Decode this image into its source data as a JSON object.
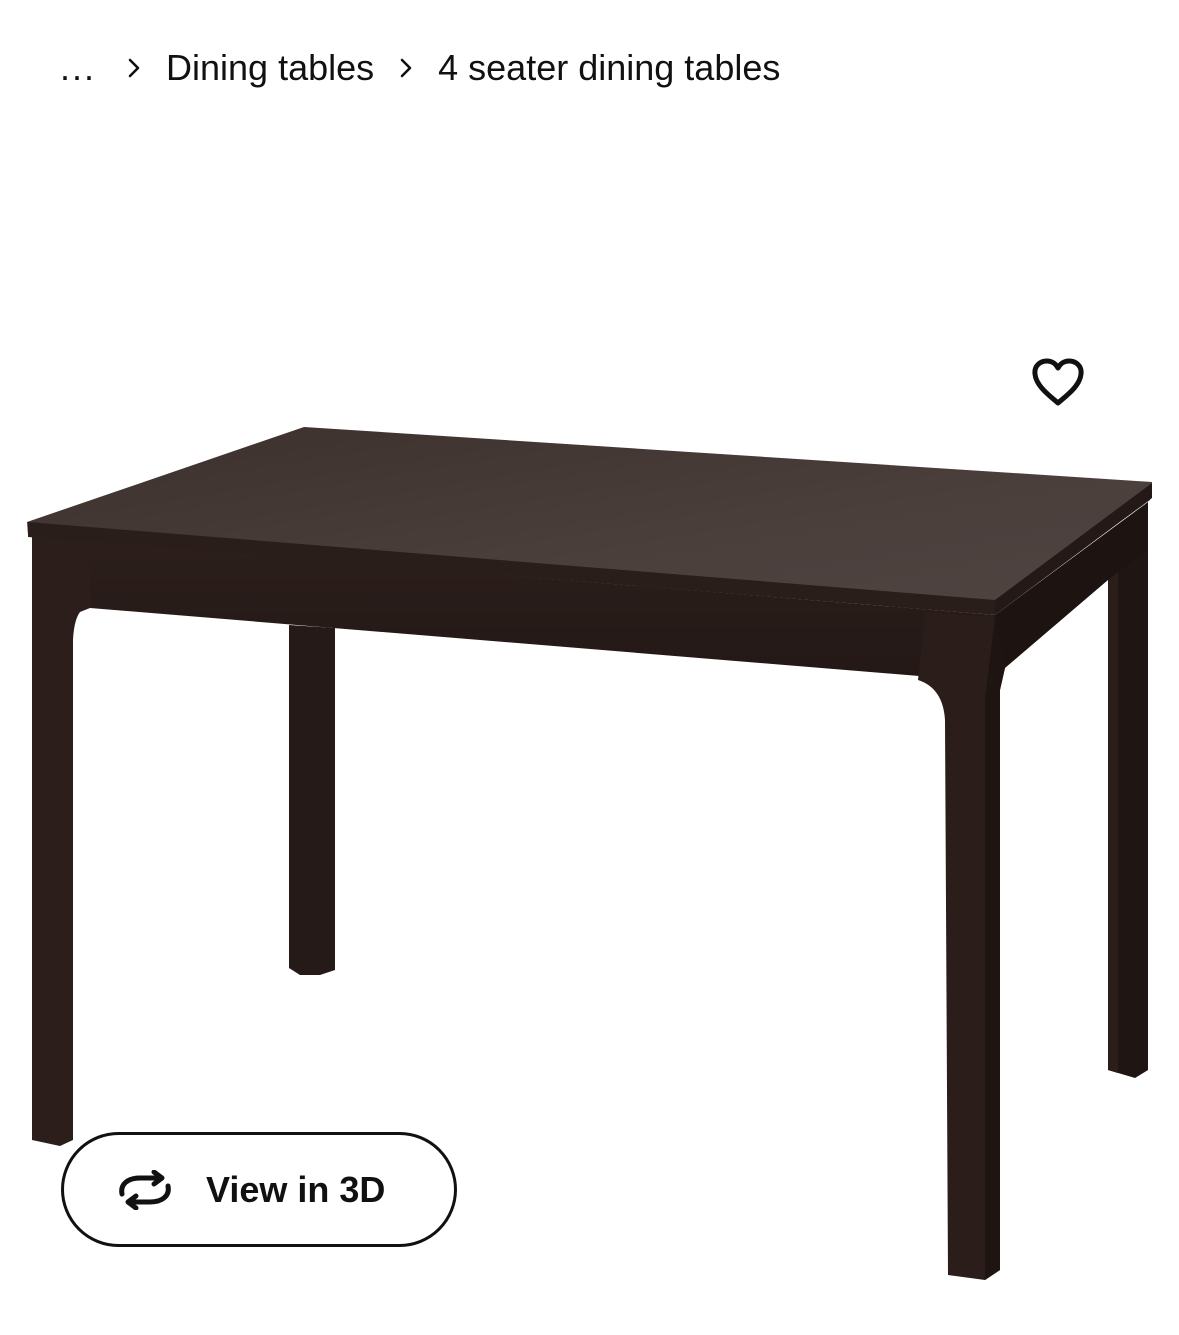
{
  "breadcrumb": {
    "ellipsis": "...",
    "items": [
      {
        "label": "Dining tables"
      },
      {
        "label": "4 seater dining tables"
      }
    ]
  },
  "product": {
    "image": {
      "icon": "dining-table-image",
      "wood_color": "#2e211e",
      "top_color": "#4a3e3b"
    },
    "favourite": {
      "icon": "heart-icon"
    },
    "view_3d": {
      "label": "View in 3D",
      "icon": "rotate-3d-icon"
    }
  }
}
